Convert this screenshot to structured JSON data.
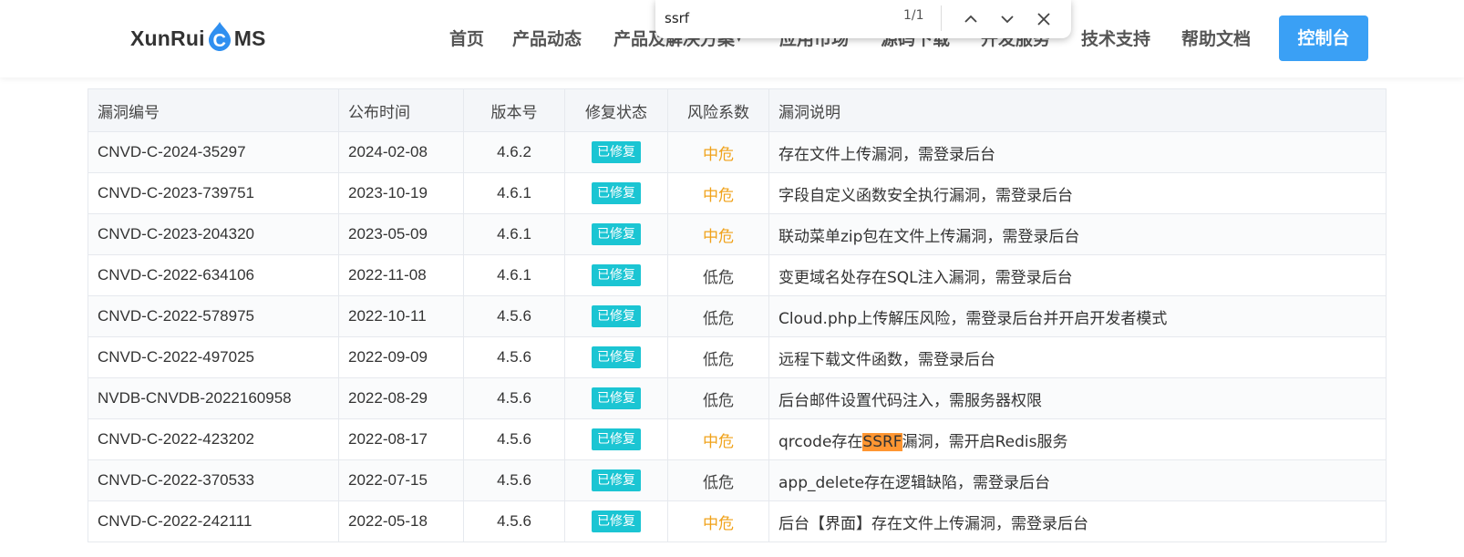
{
  "header": {
    "logo_pre": "XunRui",
    "logo_c": "C",
    "logo_post": "MS",
    "nav": [
      {
        "label": "首页",
        "caret": ""
      },
      {
        "label": "产品动态",
        "caret": ""
      },
      {
        "label": "产品及解决方案",
        "caret": "▾"
      },
      {
        "label": "应用市场",
        "caret": ""
      },
      {
        "label": "源码下载",
        "caret": ""
      },
      {
        "label": "开发服务",
        "caret": ""
      },
      {
        "label": "技术支持",
        "caret": ""
      },
      {
        "label": "帮助文档",
        "caret": ""
      }
    ],
    "console_button": "控制台"
  },
  "findbar": {
    "query": "ssrf",
    "count": "1/1"
  },
  "table": {
    "headers": [
      "漏洞编号",
      "公布时间",
      "版本号",
      "修复状态",
      "风险系数",
      "漏洞说明"
    ],
    "rows": [
      {
        "id": "CNVD-C-2024-35297",
        "date": "2024-02-08",
        "version": "4.6.2",
        "status": "已修复",
        "risk": "中危",
        "risk_level": "mid",
        "desc_before": "存在文件上传漏洞，需登录后台",
        "desc_highlight": "",
        "desc_after": ""
      },
      {
        "id": "CNVD-C-2023-739751",
        "date": "2023-10-19",
        "version": "4.6.1",
        "status": "已修复",
        "risk": "中危",
        "risk_level": "mid",
        "desc_before": "字段自定义函数安全执行漏洞，需登录后台",
        "desc_highlight": "",
        "desc_after": ""
      },
      {
        "id": "CNVD-C-2023-204320",
        "date": "2023-05-09",
        "version": "4.6.1",
        "status": "已修复",
        "risk": "中危",
        "risk_level": "mid",
        "desc_before": "联动菜单zip包在文件上传漏洞，需登录后台",
        "desc_highlight": "",
        "desc_after": ""
      },
      {
        "id": "CNVD-C-2022-634106",
        "date": "2022-11-08",
        "version": "4.6.1",
        "status": "已修复",
        "risk": "低危",
        "risk_level": "low",
        "desc_before": "变更域名处存在SQL注入漏洞，需登录后台",
        "desc_highlight": "",
        "desc_after": ""
      },
      {
        "id": "CNVD-C-2022-578975",
        "date": "2022-10-11",
        "version": "4.5.6",
        "status": "已修复",
        "risk": "低危",
        "risk_level": "low",
        "desc_before": "Cloud.php上传解压风险，需登录后台并开启开发者模式",
        "desc_highlight": "",
        "desc_after": ""
      },
      {
        "id": "CNVD-C-2022-497025",
        "date": "2022-09-09",
        "version": "4.5.6",
        "status": "已修复",
        "risk": "低危",
        "risk_level": "low",
        "desc_before": "远程下载文件函数，需登录后台",
        "desc_highlight": "",
        "desc_after": ""
      },
      {
        "id": "NVDB-CNVDB-2022160958",
        "date": "2022-08-29",
        "version": "4.5.6",
        "status": "已修复",
        "risk": "低危",
        "risk_level": "low",
        "desc_before": "后台邮件设置代码注入，需服务器权限",
        "desc_highlight": "",
        "desc_after": ""
      },
      {
        "id": "CNVD-C-2022-423202",
        "date": "2022-08-17",
        "version": "4.5.6",
        "status": "已修复",
        "risk": "中危",
        "risk_level": "mid",
        "desc_before": "qrcode存在",
        "desc_highlight": "SSRF",
        "desc_after": "漏洞，需开启Redis服务"
      },
      {
        "id": "CNVD-C-2022-370533",
        "date": "2022-07-15",
        "version": "4.5.6",
        "status": "已修复",
        "risk": "低危",
        "risk_level": "low",
        "desc_before": "app_delete存在逻辑缺陷，需登录后台",
        "desc_highlight": "",
        "desc_after": ""
      },
      {
        "id": "CNVD-C-2022-242111",
        "date": "2022-05-18",
        "version": "4.5.6",
        "status": "已修复",
        "risk": "中危",
        "risk_level": "mid",
        "desc_before": "后台【界面】存在文件上传漏洞，需登录后台",
        "desc_highlight": "",
        "desc_after": ""
      }
    ]
  },
  "colors": {
    "accent": "#3aa0f5",
    "badge": "#1bc5d3",
    "risk_mid": "#f0a21a",
    "highlight": "#ff9632"
  }
}
